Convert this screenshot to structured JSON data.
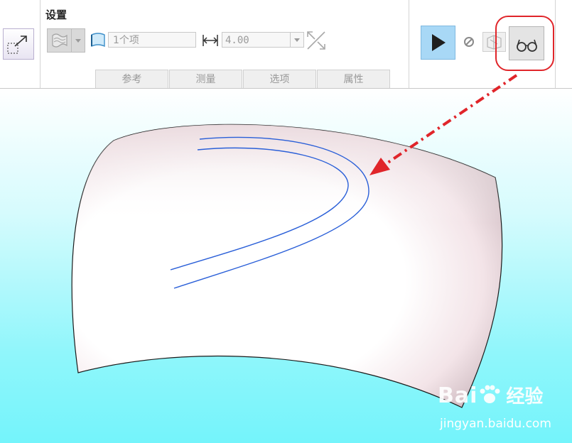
{
  "ribbon": {
    "section_title": "设置",
    "item_field": "1个项",
    "value_field": "4.00",
    "tabs": [
      "参考",
      "测量",
      "选项",
      "属性"
    ]
  },
  "icons": {
    "surface_type": "surface-type-icon",
    "quilt": "quilt-icon",
    "distance": "distance-icon",
    "flip": "flip-direction-icon",
    "play": "play-icon",
    "pause": "pause-icon",
    "preview": "verify-preview-icon",
    "glasses": "glasses-preview-icon"
  },
  "colors": {
    "accent_play": "#a8d8f6",
    "annotation_red": "#e0252a",
    "curve_blue": "#2a5fd8",
    "viewport_bottom": "#74f4fb"
  },
  "watermark": {
    "brand_prefix": "Bai",
    "brand_suffix": "经验",
    "url": "jingyan.baidu.com"
  }
}
